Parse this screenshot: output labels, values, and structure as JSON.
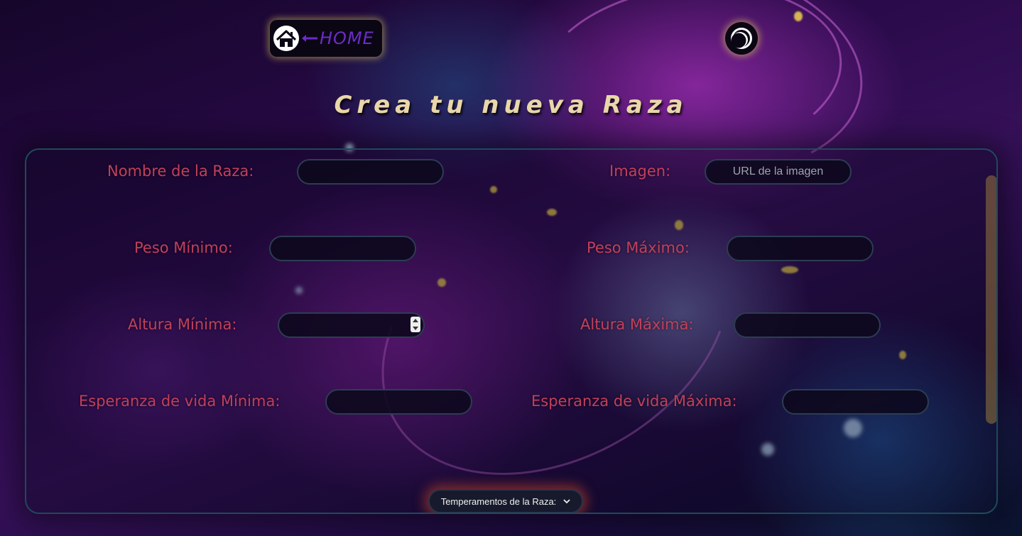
{
  "header": {
    "home_label": "HOME",
    "title": "Crea tu nueva Raza"
  },
  "icons": {
    "home": "home-icon",
    "arrow": "arrow-left-icon",
    "mode_toggle": "moon-toggle-icon",
    "select_chevron": "chevron-down-icon"
  },
  "colors": {
    "label": "#c2405c",
    "title": "#ead7a9",
    "home_text": "#6b2cc8",
    "accent_glow": "#e6d25a"
  },
  "form": {
    "name_label": "Nombre de la Raza:",
    "name_value": "",
    "image_label": "Imagen:",
    "image_placeholder": "URL de la imagen",
    "weight_min_label": "Peso Mínimo:",
    "weight_min_value": "",
    "weight_max_label": "Peso Máximo:",
    "weight_max_value": "",
    "height_min_label": "Altura Mínima:",
    "height_min_value": "",
    "height_max_label": "Altura Máxima:",
    "height_max_value": "",
    "life_min_label": "Esperanza de vida Mínima:",
    "life_min_value": "",
    "life_max_label": "Esperanza de vida Máxima:",
    "life_max_value": "",
    "temperaments_select": "Temperamentos de la Raza:"
  }
}
